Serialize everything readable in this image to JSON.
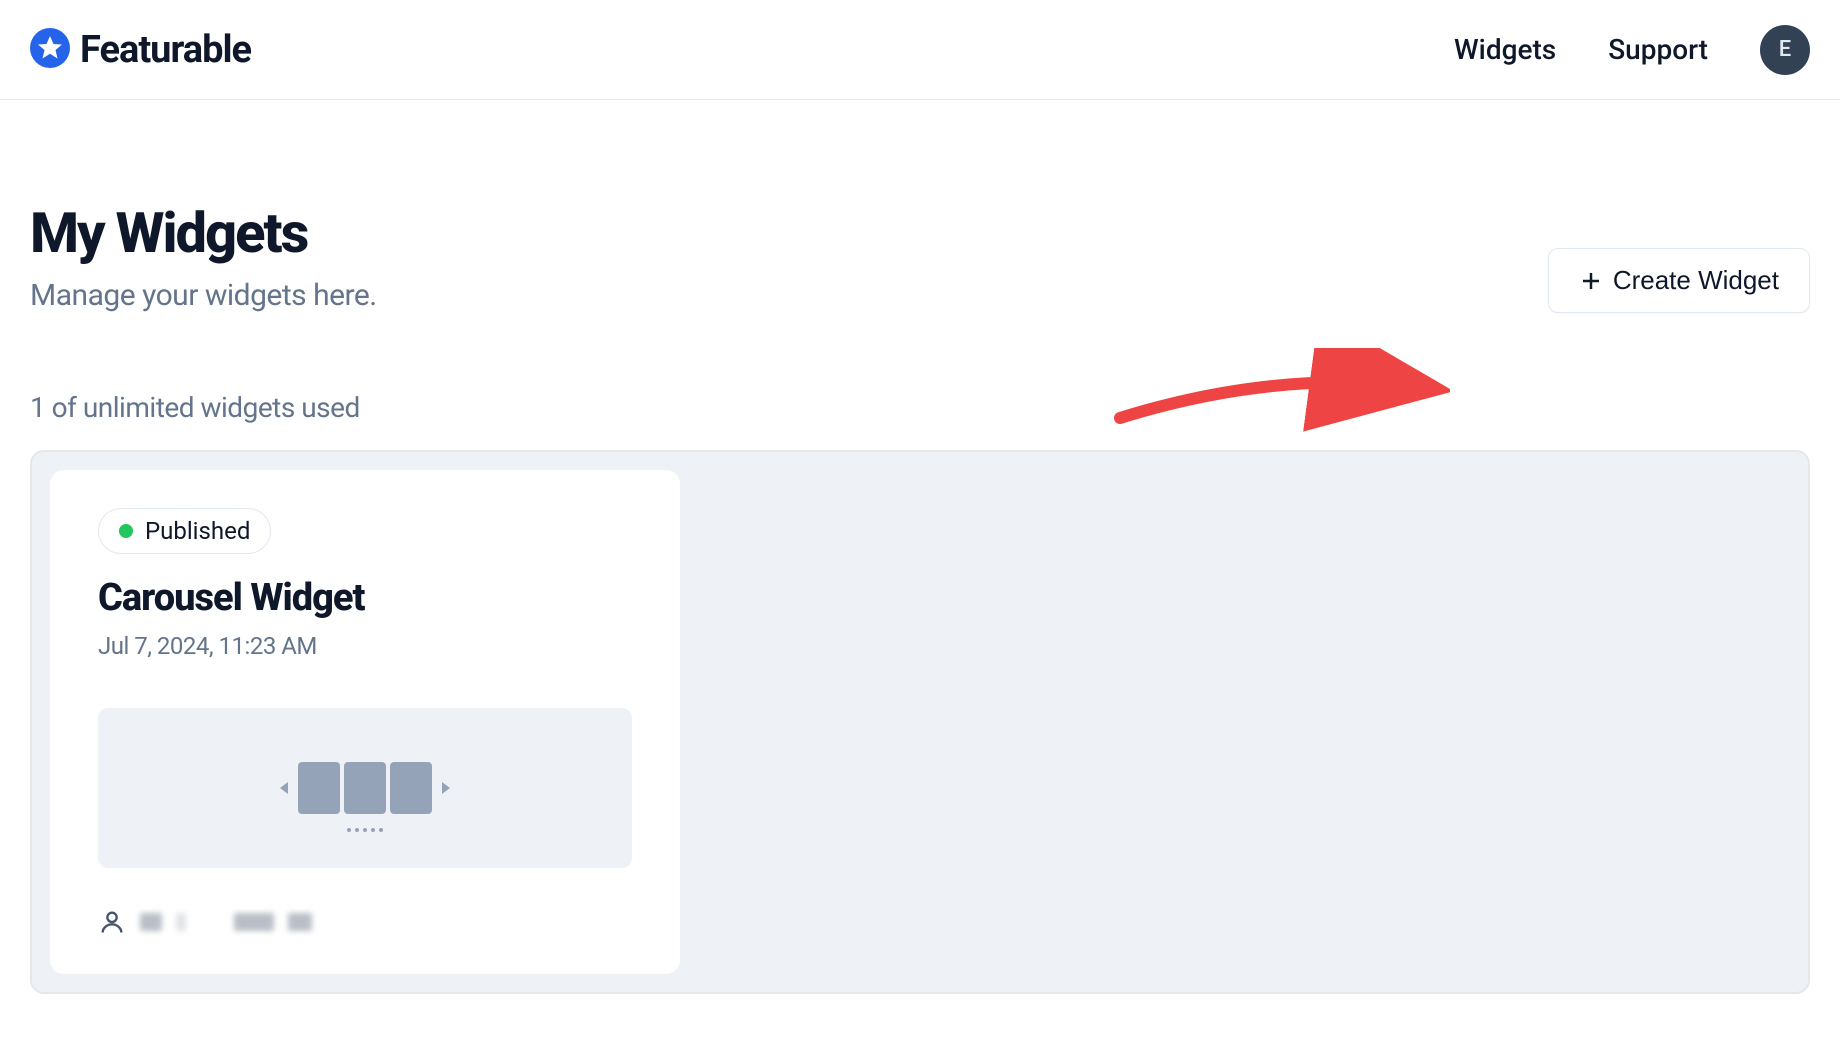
{
  "brand": {
    "name": "Featurable"
  },
  "nav": {
    "widgets": "Widgets",
    "support": "Support",
    "avatar_initial": "E"
  },
  "page": {
    "title": "My Widgets",
    "subtitle": "Manage your widgets here.",
    "usage_text": "1 of unlimited widgets used"
  },
  "actions": {
    "create_label": "Create Widget"
  },
  "widget_card": {
    "status_label": "Published",
    "title": "Carousel Widget",
    "date": "Jul 7, 2024, 11:23 AM"
  }
}
